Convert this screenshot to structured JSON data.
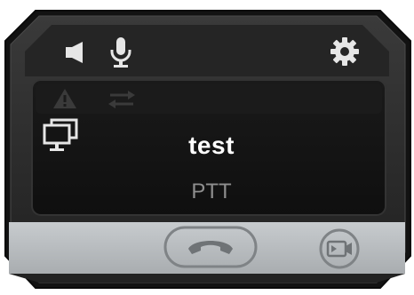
{
  "window": {
    "toolbar": {
      "speaker_icon": "speaker-icon",
      "mic_icon": "microphone-icon",
      "settings_icon": "gear-icon"
    },
    "status_bar": {
      "warning_icon": "warning-icon",
      "transfer_icon": "transfer-arrows-icon"
    },
    "screen_icon": "screen-share-icon",
    "contact": {
      "name": "test",
      "type": "PTT"
    },
    "bottom_bar": {
      "hangup_icon": "hang-up-icon",
      "video_icon": "video-camera-icon"
    }
  },
  "colors": {
    "frame_outer": "#1a1a1a",
    "frame_inner": "#2b2b2b",
    "display_bg": "#141414",
    "bottom_bar": "#b6babd",
    "icon_light": "#e6e6e6",
    "icon_dim": "#3a3a3a",
    "text_secondary": "#8e8e8e"
  }
}
